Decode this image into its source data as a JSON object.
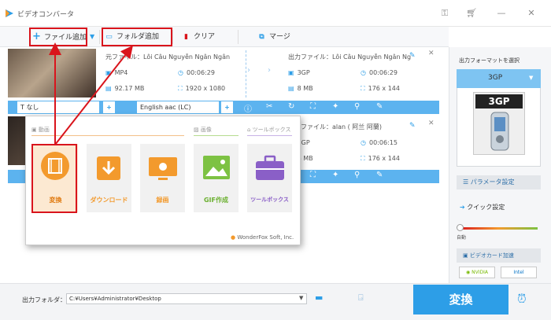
{
  "window": {
    "title": "ビデオコンバータ"
  },
  "toolbar": {
    "add_file": "ファイル追加",
    "add_folder": "フォルダ追加",
    "clear": "クリア",
    "merge": "マージ"
  },
  "task1": {
    "source_file": "元ファイル：Lôi Câu Nguyễn Ngân Ngân",
    "format": "MP4",
    "duration": "00:06:29",
    "size": "92.17 MB",
    "resolution": "1920 x 1080",
    "output_file": "出力ファイル：Lôi Câu Nguyễn Ngân Ng",
    "out_format": "3GP",
    "out_duration": "00:06:29",
    "out_size": "8 MB",
    "out_resolution": "176 x 144",
    "subtitle": "なし",
    "audio": "English aac (LC)"
  },
  "task2": {
    "output_file": "出力ファイル：alan ( 阿兰 阿蘭)",
    "out_format": "3GP",
    "out_duration": "00:06:15",
    "out_size": "8 MB",
    "out_resolution": "176 x 144"
  },
  "popup": {
    "section_video": "動画",
    "section_image": "画像",
    "section_toolbox": "ツールボックス",
    "tiles": [
      {
        "label": "変換",
        "color": "#f39a2d"
      },
      {
        "label": "ダウンロード",
        "color": "#f39a2d"
      },
      {
        "label": "録画",
        "color": "#f39a2d"
      },
      {
        "label": "GIF作成",
        "color": "#7dc243"
      },
      {
        "label": "ツールボックス",
        "color": "#8a5fc7"
      }
    ],
    "brand": "WonderFox Soft, Inc."
  },
  "right_panel": {
    "title": "出力フォーマットを選択",
    "selected_format": "3GP",
    "format_badge": "3GP",
    "param_settings": "パラメータ設定",
    "quick_settings": "クイック設定",
    "auto": "自動",
    "hw_accel": "ビデオカード加速",
    "nvidia": "NVIDIA",
    "intel": "Intel"
  },
  "bottom": {
    "output_folder_label": "出力フォルダ：",
    "output_path": "C:¥Users¥Administrator¥Desktop",
    "convert": "変換"
  },
  "colors": {
    "accent": "#2d9ee7",
    "highlight": "#d9141c",
    "orange": "#f39a2d"
  }
}
